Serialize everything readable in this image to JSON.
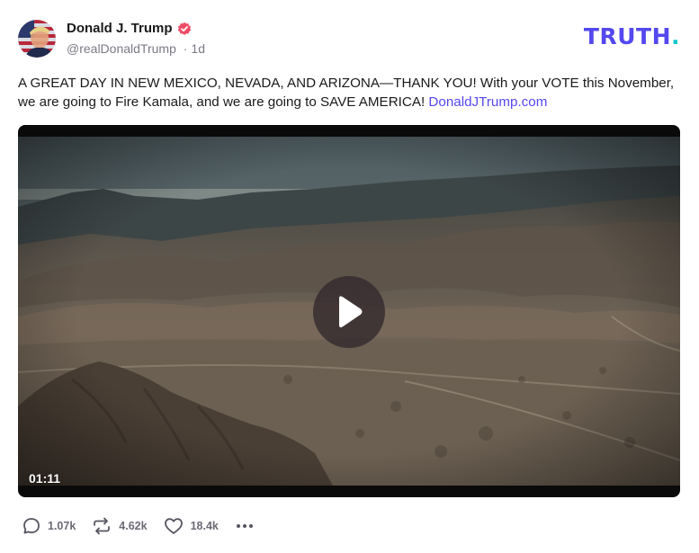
{
  "post": {
    "author_name": "Donald J. Trump",
    "handle": "@realDonaldTrump",
    "separator": "·",
    "time_ago": "1d",
    "text": "A GREAT DAY IN NEW MEXICO, NEVADA, AND ARIZONA—THANK YOU! With your VOTE this November, we are going to Fire Kamala, and we are going to SAVE AMERICA! ",
    "link_text": "DonaldJTrump.com"
  },
  "brand": {
    "name": "TRUTH",
    "dot": ".",
    "color": "#5448ee",
    "dot_color": "#17c7cf"
  },
  "video": {
    "duration": "01:11"
  },
  "actions": {
    "replies": "1.07k",
    "retruths": "4.62k",
    "likes": "18.4k"
  },
  "icons": {
    "verified": "verified-badge-icon",
    "play": "play-icon",
    "reply": "comment-bubble-icon",
    "retruth": "repost-arrows-icon",
    "like": "heart-icon",
    "more": "more-dots-icon"
  }
}
